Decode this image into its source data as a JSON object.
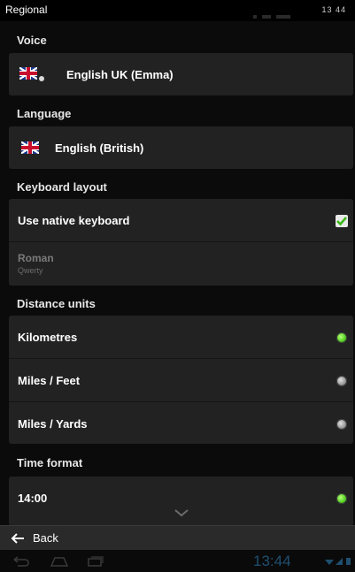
{
  "status_bar": {
    "title": "Regional",
    "time": "13 44"
  },
  "sections": {
    "voice": {
      "label": "Voice",
      "value": "English UK (Emma)"
    },
    "language": {
      "label": "Language",
      "value": "English (British)"
    },
    "keyboard": {
      "label": "Keyboard layout",
      "native_label": "Use native keyboard",
      "native_checked": true,
      "layout_title": "Roman",
      "layout_sub": "Qwerty"
    },
    "distance": {
      "label": "Distance units",
      "options": [
        {
          "label": "Kilometres",
          "selected": true
        },
        {
          "label": "Miles / Feet",
          "selected": false
        },
        {
          "label": "Miles / Yards",
          "selected": false
        }
      ]
    },
    "time": {
      "label": "Time format",
      "options": [
        {
          "label": "14:00",
          "selected": true
        }
      ]
    }
  },
  "footer": {
    "back_label": "Back"
  },
  "system_nav": {
    "clock": "13:44"
  },
  "colors": {
    "accent_green": "#4fcf1e",
    "card": "#222222",
    "background": "#0b0b0b"
  }
}
